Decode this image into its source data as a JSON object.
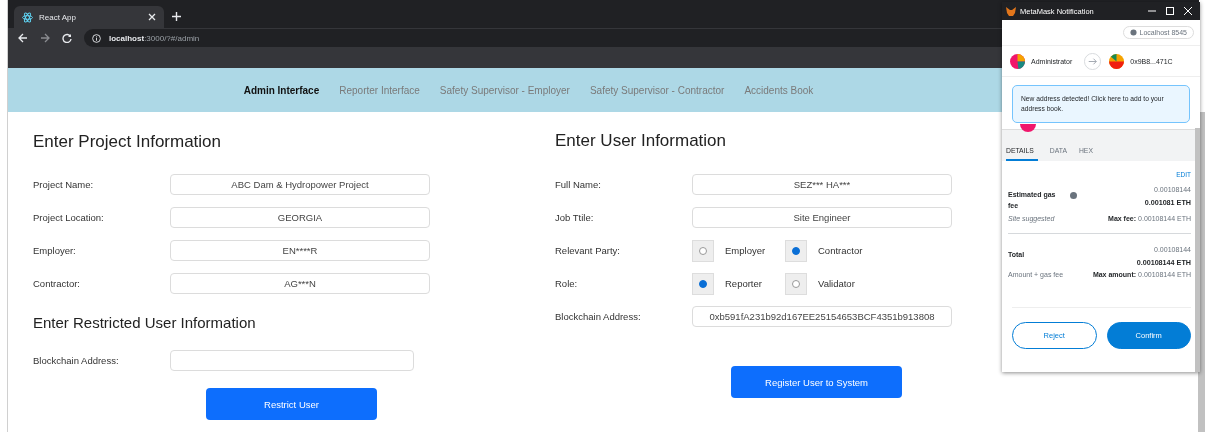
{
  "browser": {
    "tab_title": "React App",
    "url_host": "localhost",
    "url_path": ":3000/?#/admin"
  },
  "nav": [
    {
      "label": "Admin Interface",
      "selected": true
    },
    {
      "label": "Reporter Interface",
      "selected": false
    },
    {
      "label": "Safety Supervisor - Employer",
      "selected": false
    },
    {
      "label": "Safety Supervisor - Contractor",
      "selected": false
    },
    {
      "label": "Accidents Book",
      "selected": false
    }
  ],
  "project_form": {
    "title": "Enter Project Information",
    "fields": [
      {
        "label": "Project Name:",
        "value": "ABC Dam & Hydropower Project"
      },
      {
        "label": "Project Location:",
        "value": "GEORGIA"
      },
      {
        "label": "Employer:",
        "value": "EN****R"
      },
      {
        "label": "Contractor:",
        "value": "AG***N"
      }
    ]
  },
  "restricted_form": {
    "title": "Enter Restricted User Information",
    "fields": [
      {
        "label": "Blockchain Address:"
      }
    ],
    "button": "Restrict User"
  },
  "user_form": {
    "title": "Enter User Information",
    "rows": [
      {
        "kind": "text",
        "label": "Full Name:",
        "value": "SEZ*** HA***"
      },
      {
        "kind": "text",
        "label": "Job Ttile:",
        "value": "Site Engineer"
      },
      {
        "kind": "radio",
        "label": "Relevant Party:",
        "options": [
          {
            "label": "Employer",
            "selected": false
          },
          {
            "label": "Contractor",
            "selected": true
          }
        ]
      },
      {
        "kind": "radio",
        "label": "Role:",
        "options": [
          {
            "label": "Reporter",
            "selected": true
          },
          {
            "label": "Validator",
            "selected": false
          }
        ]
      },
      {
        "kind": "text",
        "label": "Blockchain Address:",
        "value": "0xb591fA231b92d167EE25154653BCF4351b913808"
      }
    ],
    "button": "Register User to System"
  },
  "metamask": {
    "title": "MetaMask Notification",
    "network": "Localhost 8545",
    "from_account": "Administrator",
    "to_account": "0x9B8...471C",
    "notice": "New address detected! Click here to add to your address book.",
    "tabs": [
      {
        "label": "DETAILS",
        "selected": true
      },
      {
        "label": "DATA",
        "selected": false
      },
      {
        "label": "HEX",
        "selected": false
      }
    ],
    "edit": "EDIT",
    "gas": {
      "label": "Estimated gas fee",
      "secondary": "0.00108144",
      "primary": "0.001081 ETH",
      "note": "Site suggested",
      "max_label": "Max fee:",
      "max_value": "0.00108144 ETH"
    },
    "total": {
      "label": "Total",
      "secondary": "0.00108144",
      "primary": "0.00108144 ETH",
      "note": "Amount + gas fee",
      "max_label": "Max amount:",
      "max_value": "0.00108144 ETH"
    },
    "buttons": [
      "Reject",
      "Confirm"
    ]
  }
}
